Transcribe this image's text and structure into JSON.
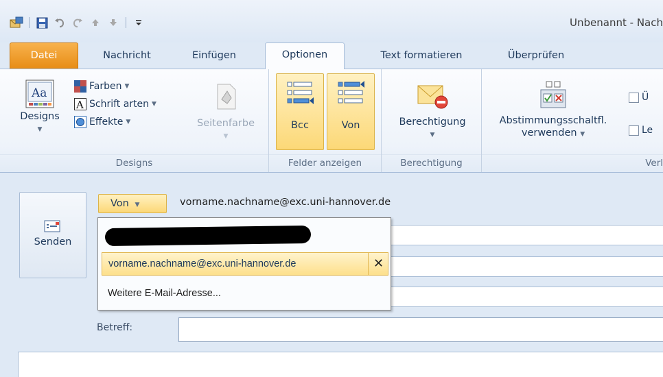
{
  "window": {
    "title": "Unbenannt - Nach"
  },
  "tabs": [
    {
      "label": "Datei"
    },
    {
      "label": "Nachricht"
    },
    {
      "label": "Einfügen"
    },
    {
      "label": "Optionen"
    },
    {
      "label": "Text formatieren"
    },
    {
      "label": "Überprüfen"
    }
  ],
  "ribbon": {
    "designs_group": {
      "label": "Designs",
      "designs_button": "Designs",
      "farben": "Farben",
      "schriftarten": "Schrift arten",
      "effekte": "Effekte",
      "seitenfarbe": "Seitenfarbe"
    },
    "felder_group": {
      "label": "Felder anzeigen",
      "bcc": "Bcc",
      "von": "Von"
    },
    "berechtigung_group": {
      "label": "Berechtigung",
      "berechtigung": "Berechtigung"
    },
    "verl_group": {
      "label": "Verl",
      "abstimmung_line1": "Abstimmungsschaltfl.",
      "abstimmung_line2": "verwenden",
      "check1": "Ü",
      "check2": "Le"
    }
  },
  "compose": {
    "send_label": "Senden",
    "von_label": "Von",
    "from_address": "vorname.nachname@exc.uni-hannover.de",
    "betreff_label": "Betreff:"
  },
  "dropdown": {
    "selected_address": "vorname.nachname@exc.uni-hannover.de",
    "remove_symbol": "✕",
    "more_label": "Weitere E-Mail-Adresse..."
  }
}
